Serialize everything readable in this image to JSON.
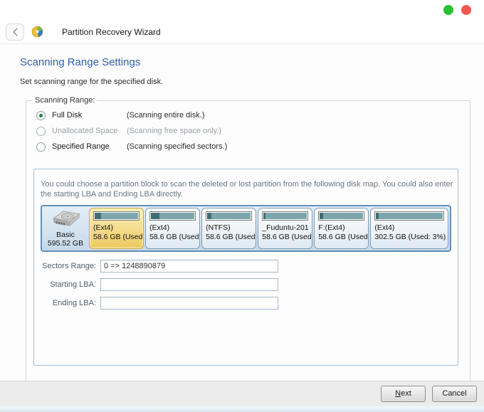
{
  "window": {
    "title": "Partition Recovery Wizard"
  },
  "page": {
    "title": "Scanning Range Settings",
    "subtitle": "Set scanning range for the specified disk."
  },
  "scanning_range": {
    "legend": "Scanning Range:",
    "options": [
      {
        "label": "Full Disk",
        "note": "(Scanning entire disk.)",
        "selected": true,
        "disabled": false
      },
      {
        "label": "Unallocated Space",
        "note": "(Scanning free space only.)",
        "selected": false,
        "disabled": true
      },
      {
        "label": "Specified Range",
        "note": "(Scanning specified sectors.)",
        "selected": false,
        "disabled": false
      }
    ]
  },
  "panel": {
    "description": "You could choose a partition block to scan the deleted or lost partition from the following disk map. You could also enter the starting LBA and Ending LBA directly."
  },
  "disk_map": {
    "disk": {
      "type": "Basic",
      "size": "595.52 GB"
    },
    "partitions": [
      {
        "label": "(Ext4)",
        "size": "58.6 GB (Used",
        "selected": true,
        "used_pct": 14
      },
      {
        "label": "(Ext4)",
        "size": "58.6 GB (Used",
        "selected": false,
        "used_pct": 20
      },
      {
        "label": "(NTFS)",
        "size": "58.6 GB (Used",
        "selected": false,
        "used_pct": 9
      },
      {
        "label": "_Fuduntu-201",
        "size": "58.6 GB (Used",
        "selected": false,
        "used_pct": 5
      },
      {
        "label": "F:(Ext4)",
        "size": "58.6 GB (Used",
        "selected": false,
        "used_pct": 7
      },
      {
        "label": "(Ext4)",
        "size": "302.5 GB (Used: 3%)",
        "selected": false,
        "used_pct": 4
      }
    ]
  },
  "fields": [
    {
      "label": "Sectors Range:",
      "value": "0 => 1248890879"
    },
    {
      "label": "Starting LBA:",
      "value": ""
    },
    {
      "label": "Ending LBA:",
      "value": ""
    }
  ],
  "footer": {
    "next_label": "Next",
    "cancel_label": "Cancel"
  }
}
